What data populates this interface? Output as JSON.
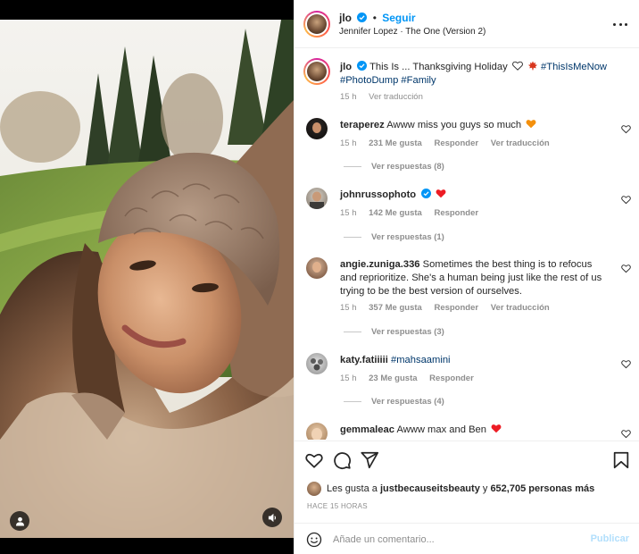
{
  "header": {
    "username": "jlo",
    "separator": "•",
    "follow_label": "Seguir",
    "audio": "Jennifer Lopez · The One (Version 2)"
  },
  "caption": {
    "username": "jlo",
    "text_before": "This Is ... Thanksgiving Holiday",
    "hashtag1": "#ThisIsMeNow",
    "hashtag2": "#PhotoDump",
    "hashtag3": "#Family",
    "time": "15 h",
    "translate": "Ver traducción"
  },
  "comments": [
    {
      "username": "teraperez",
      "text": "Awww miss you guys so much",
      "time": "15 h",
      "likes": "231 Me gusta",
      "reply": "Responder",
      "translate": "Ver traducción",
      "view_replies": "Ver respuestas (8)"
    },
    {
      "username": "johnrussophoto",
      "text": "",
      "time": "15 h",
      "likes": "142 Me gusta",
      "reply": "Responder",
      "view_replies": "Ver respuestas (1)"
    },
    {
      "username": "angie.zuniga.336",
      "text": "Sometimes the best thing is to refocus and reprioritize. She's a human being just like the rest of us trying to be the best version of ourselves.",
      "time": "15 h",
      "likes": "357 Me gusta",
      "reply": "Responder",
      "translate": "Ver traducción",
      "view_replies": "Ver respuestas (3)"
    },
    {
      "username": "katy.fatiiiii",
      "text": "#mahsaamini",
      "time": "15 h",
      "likes": "23 Me gusta",
      "reply": "Responder",
      "view_replies": "Ver respuestas (4)"
    },
    {
      "username": "gemmaleac",
      "text": "Awww max and Ben"
    }
  ],
  "likes": {
    "prefix": "Les gusta a",
    "user": "justbecauseitsbeauty",
    "middle": "y",
    "count": "652,705 personas más"
  },
  "timestamp": "HACE 15 HORAS",
  "composer": {
    "placeholder": "Añade un comentario...",
    "post_label": "Publicar"
  },
  "colors": {
    "accent": "#0095f6",
    "heart_red": "#ed4956",
    "orange_heart": "#f4900c",
    "hashtag": "#00376b"
  },
  "icons": [
    "verified-icon",
    "more-icon",
    "heart-icon",
    "comment-icon",
    "share-icon",
    "bookmark-icon",
    "emoji-icon",
    "user-tag-icon",
    "sound-icon"
  ]
}
